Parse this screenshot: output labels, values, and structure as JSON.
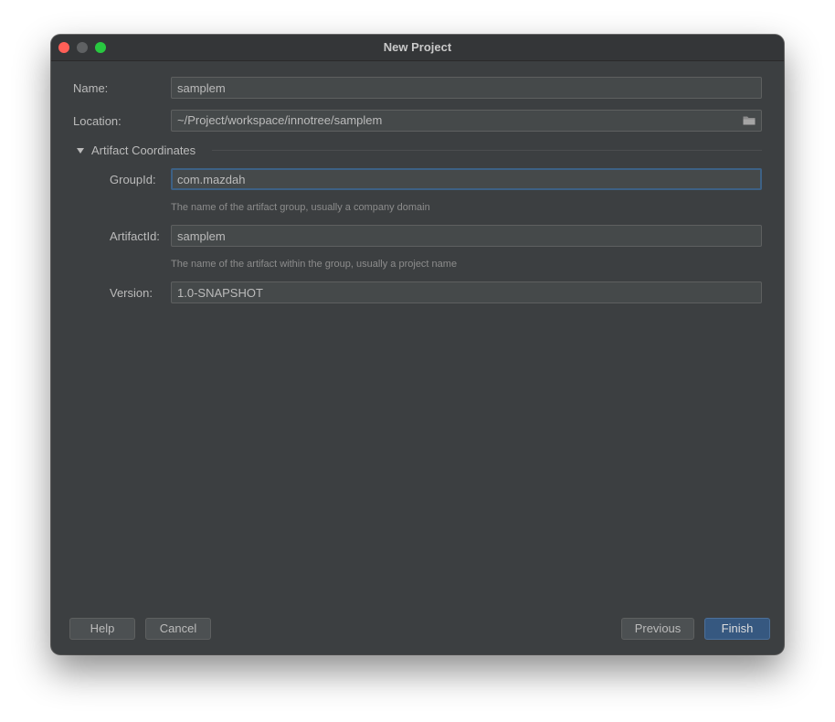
{
  "window": {
    "title": "New Project"
  },
  "form": {
    "name": {
      "label": "Name:",
      "value": "samplem"
    },
    "location": {
      "label": "Location:",
      "value": "~/Project/workspace/innotree/samplem",
      "icon": "folder-icon"
    },
    "section": {
      "label": "Artifact Coordinates",
      "expanded": true
    },
    "groupId": {
      "label": "GroupId:",
      "value": "com.mazdah",
      "hint": "The name of the artifact group, usually a company domain"
    },
    "artifactId": {
      "label": "ArtifactId:",
      "value": "samplem",
      "hint": "The name of the artifact within the group, usually a project name"
    },
    "version": {
      "label": "Version:",
      "value": "1.0-SNAPSHOT"
    }
  },
  "buttons": {
    "help": "Help",
    "cancel": "Cancel",
    "previous": "Previous",
    "finish": "Finish"
  },
  "colors": {
    "background": "#3c3f41",
    "primary_button": "#365880",
    "focus_border": "#3d6185",
    "close": "#ff5f57",
    "maximize": "#28c840"
  }
}
